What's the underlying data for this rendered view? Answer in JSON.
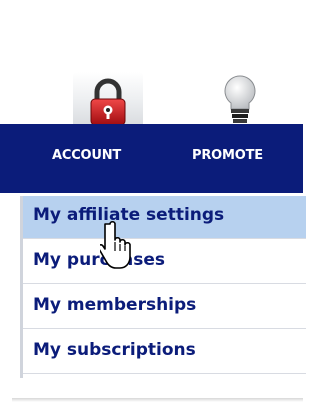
{
  "icons": {
    "account": "lock-icon",
    "promote": "lightbulb-icon",
    "pointer": "hand-cursor-icon"
  },
  "nav": {
    "tabs": [
      {
        "label": "ACCOUNT"
      },
      {
        "label": "PROMOTE"
      }
    ]
  },
  "menu": {
    "items": [
      {
        "label": "My affiliate settings",
        "highlighted": true
      },
      {
        "label": "My purchases",
        "highlighted": false
      },
      {
        "label": "My memberships",
        "highlighted": false
      },
      {
        "label": "My subscriptions",
        "highlighted": false
      }
    ]
  },
  "colors": {
    "nav_bg": "#0b1c7a",
    "menu_text": "#0b1c7a",
    "menu_highlight": "#b7d1ef",
    "lock_red": "#c0141b"
  }
}
